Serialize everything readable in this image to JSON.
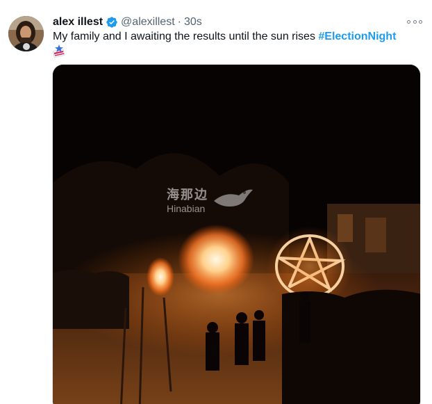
{
  "tweet": {
    "display_name": "alex illest",
    "handle": "@alexillest",
    "separator": "·",
    "time": "30s",
    "text": "My family and I awaiting the results until the sun rises ",
    "hashtag": "#ElectionNight",
    "hashtag_color": "#1d9bf0"
  },
  "media": {
    "watermark_cn": "海那边",
    "watermark_en": "Hinabian"
  },
  "icons": {
    "verified": "verified-badge-icon",
    "more": "more-options-icon",
    "emoji": "vote-emoji-icon"
  },
  "colors": {
    "text_primary": "#0f1419",
    "text_secondary": "#536471",
    "verified_blue": "#1d9bf0"
  }
}
